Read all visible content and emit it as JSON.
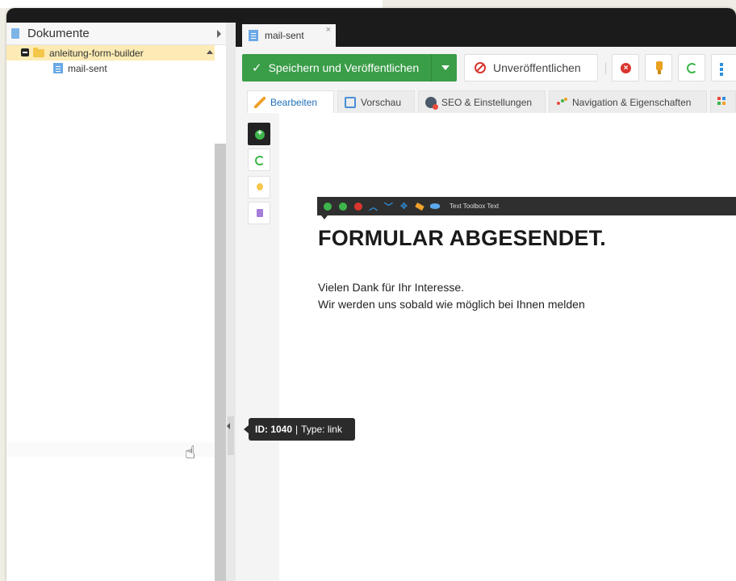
{
  "tree": {
    "header_title": "Dokumente",
    "folder_label": "anleitung-form-builder",
    "page_label": "mail-sent"
  },
  "tab": {
    "title": "mail-sent",
    "close_glyph": "×"
  },
  "toolbar": {
    "save_label": "Speichern und Veröffentlichen",
    "unpublish_label": "Unveröffentlichen"
  },
  "edit_tabs": [
    {
      "label": "Bearbeiten",
      "icon": "pencil-icon"
    },
    {
      "label": "Vorschau",
      "icon": "preview-icon"
    },
    {
      "label": "SEO & Einstellungen",
      "icon": "gear-icon"
    },
    {
      "label": "Navigation & Eigenschaften",
      "icon": "navigation-icon"
    }
  ],
  "text_toolbar_label": "Text Toolbox Text",
  "content": {
    "heading": "FORMULAR ABGESENDET.",
    "line1": "Vielen Dank für Ihr Interesse.",
    "line2": "Wir werden uns sobald wie möglich bei Ihnen melden"
  },
  "tooltip": {
    "id": "ID: 1040",
    "sep": "|",
    "type": "Type: link"
  },
  "colors": {
    "save_green": "#3a9d48",
    "danger_red": "#d9352e",
    "active_tab_blue": "#1f6fb8",
    "tree_selected": "#fcebb4",
    "dark_bar": "#1b1b1b"
  }
}
